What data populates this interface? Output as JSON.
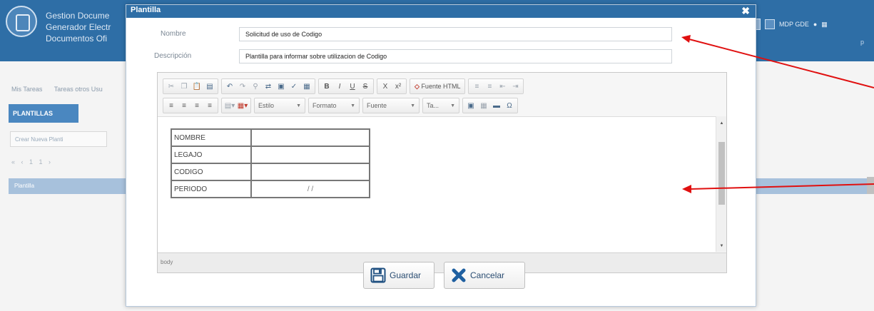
{
  "background_app": {
    "title_lines": [
      "Gestion Docume",
      "Generador Electr",
      "Documentos Ofi"
    ],
    "user_label": "MDP GDE",
    "user_sub": "p",
    "nav_items": [
      "Mis Tareas",
      "Tareas otros Usu"
    ],
    "active_tab": "PLANTILLAS",
    "new_button": "Crear Nueva Planti",
    "pager": "« ‹ 1 1 ›",
    "table_header": "Plantilla"
  },
  "modal": {
    "title": "Plantilla",
    "close_glyph": "✖",
    "fields": {
      "nombre_label": "Nombre",
      "nombre_value": "Solicitud de uso de Codigo",
      "descripcion_label": "Descripción",
      "descripcion_value": "Plantilla para informar sobre utilizacion de Codigo"
    },
    "toolbar": {
      "row1_group1": [
        "scissors-icon",
        "copy-icon",
        "paste-icon",
        "paste-word-icon"
      ],
      "row1_group2": [
        "undo-icon",
        "redo-icon",
        "find-icon",
        "replace-icon",
        "select-all-icon",
        "spellcheck-icon",
        "grid-icon"
      ],
      "row1_group3": [
        "B",
        "I",
        "U",
        "S"
      ],
      "row1_group4": [
        "X",
        "x²"
      ],
      "fuente_html_label": "Fuente HTML",
      "fuente_html_mark": "◇",
      "row1_group5": [
        "numbered-list-icon",
        "bulleted-list-icon",
        "outdent-icon",
        "indent-icon"
      ],
      "row2_group1": [
        "align-left-icon",
        "align-center-icon",
        "align-right-icon",
        "justify-icon"
      ],
      "combo_estilo": "Estilo",
      "combo_formato": "Formato",
      "combo_fuente": "Fuente",
      "combo_tamano": "Ta...",
      "row2_group2": [
        "image-icon",
        "table-icon",
        "horizontal-rule-icon",
        "special-char-icon"
      ]
    },
    "content_table": [
      {
        "key": "NOMBRE",
        "value": ""
      },
      {
        "key": "LEGAJO",
        "value": ""
      },
      {
        "key": "CODIGO",
        "value": ""
      },
      {
        "key": "PERIODO",
        "value": "/ /"
      }
    ],
    "status_path": "body",
    "buttons": {
      "save": "Guardar",
      "cancel": "Cancelar"
    }
  },
  "colors": {
    "header_blue": "#2e6ea6",
    "annotation_red": "#e01010",
    "cancel_x": "#1e5fa0"
  }
}
